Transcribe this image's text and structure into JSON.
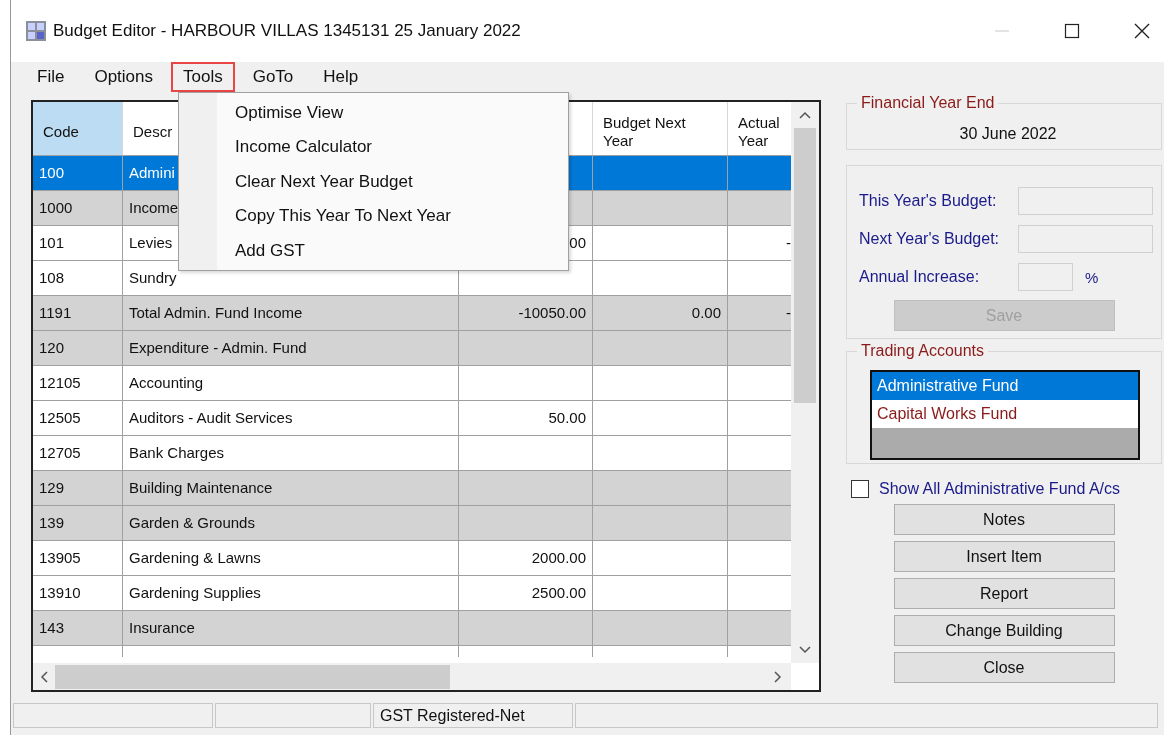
{
  "window": {
    "title": "Budget Editor - HARBOUR VILLAS 1345131 25 January 2022"
  },
  "menu": [
    {
      "label": "File",
      "selected": false
    },
    {
      "label": "Options",
      "selected": false
    },
    {
      "label": "Tools",
      "selected": true
    },
    {
      "label": "GoTo",
      "selected": false
    },
    {
      "label": "Help",
      "selected": false
    }
  ],
  "dropdown": {
    "items": [
      {
        "label": "Optimise View"
      },
      {
        "label": "Income Calculator"
      },
      {
        "label": "Clear Next Year Budget"
      },
      {
        "label": "Copy This Year To Next Year"
      },
      {
        "label": "Add GST"
      }
    ]
  },
  "table": {
    "columns": [
      {
        "label": "Code",
        "selected": true
      },
      {
        "label": "Descr",
        "selected": false
      },
      {
        "selected": false
      },
      {
        "label": "Budget Next Year",
        "selected": false
      },
      {
        "label": "Actual Year",
        "selected": false
      }
    ],
    "rows": [
      {
        "kind": "heading",
        "selected": true,
        "cells": [
          "100",
          "Admini"
        ]
      },
      {
        "kind": "heading",
        "selected": false,
        "cells": [
          "1000",
          "Income"
        ]
      },
      {
        "kind": "account",
        "selected": false,
        "cells": [
          "101",
          "Levies",
          "00",
          null,
          "-"
        ]
      },
      {
        "kind": "account",
        "selected": false,
        "cells": [
          "108",
          "Sundry"
        ]
      },
      {
        "kind": "heading",
        "selected": false,
        "cells": [
          "1191",
          "Total Admin. Fund Income",
          "-10050.00",
          "0.00",
          "-"
        ]
      },
      {
        "kind": "heading",
        "selected": false,
        "cells": [
          "120",
          "Expenditure - Admin. Fund"
        ]
      },
      {
        "kind": "account",
        "selected": false,
        "cells": [
          "12105",
          "Accounting"
        ]
      },
      {
        "kind": "account",
        "selected": false,
        "cells": [
          "12505",
          "Auditors - Audit Services",
          "50.00"
        ]
      },
      {
        "kind": "account",
        "selected": false,
        "cells": [
          "12705",
          "Bank Charges"
        ]
      },
      {
        "kind": "heading",
        "selected": false,
        "cells": [
          "129",
          "Building Maintenance"
        ]
      },
      {
        "kind": "heading",
        "selected": false,
        "cells": [
          "139",
          "Garden & Grounds"
        ]
      },
      {
        "kind": "account",
        "selected": false,
        "cells": [
          "13905",
          "Gardening & Lawns",
          "2000.00"
        ]
      },
      {
        "kind": "account",
        "selected": false,
        "cells": [
          "13910",
          "Gardening Supplies",
          "2500.00"
        ]
      },
      {
        "kind": "heading",
        "selected": false,
        "cells": [
          "143",
          "Insurance"
        ]
      }
    ]
  },
  "financial_year_end": {
    "title": "Financial Year End",
    "value": "30 June 2022"
  },
  "budget": {
    "fields": [
      {
        "label": "This Year's Budget:",
        "kind": "wide"
      },
      {
        "label": "Next Year's Budget:",
        "kind": "wide"
      },
      {
        "label": "Annual Increase:",
        "kind": "percent",
        "suffix": "%"
      }
    ],
    "save_button": {
      "label": "Save",
      "disabled": true
    }
  },
  "trading_accounts": {
    "title": "Trading Accounts",
    "items": [
      {
        "label": "Administrative Fund",
        "selected": true
      },
      {
        "label": "Capital Works Fund",
        "selected": false
      }
    ]
  },
  "show_all": {
    "label": "Show All Administrative Fund A/cs",
    "checked": false
  },
  "buttons": [
    "Notes",
    "Insert Item",
    "Report",
    "Change Building",
    "Close"
  ],
  "status_bar": {
    "text": "GST Registered-Net"
  }
}
